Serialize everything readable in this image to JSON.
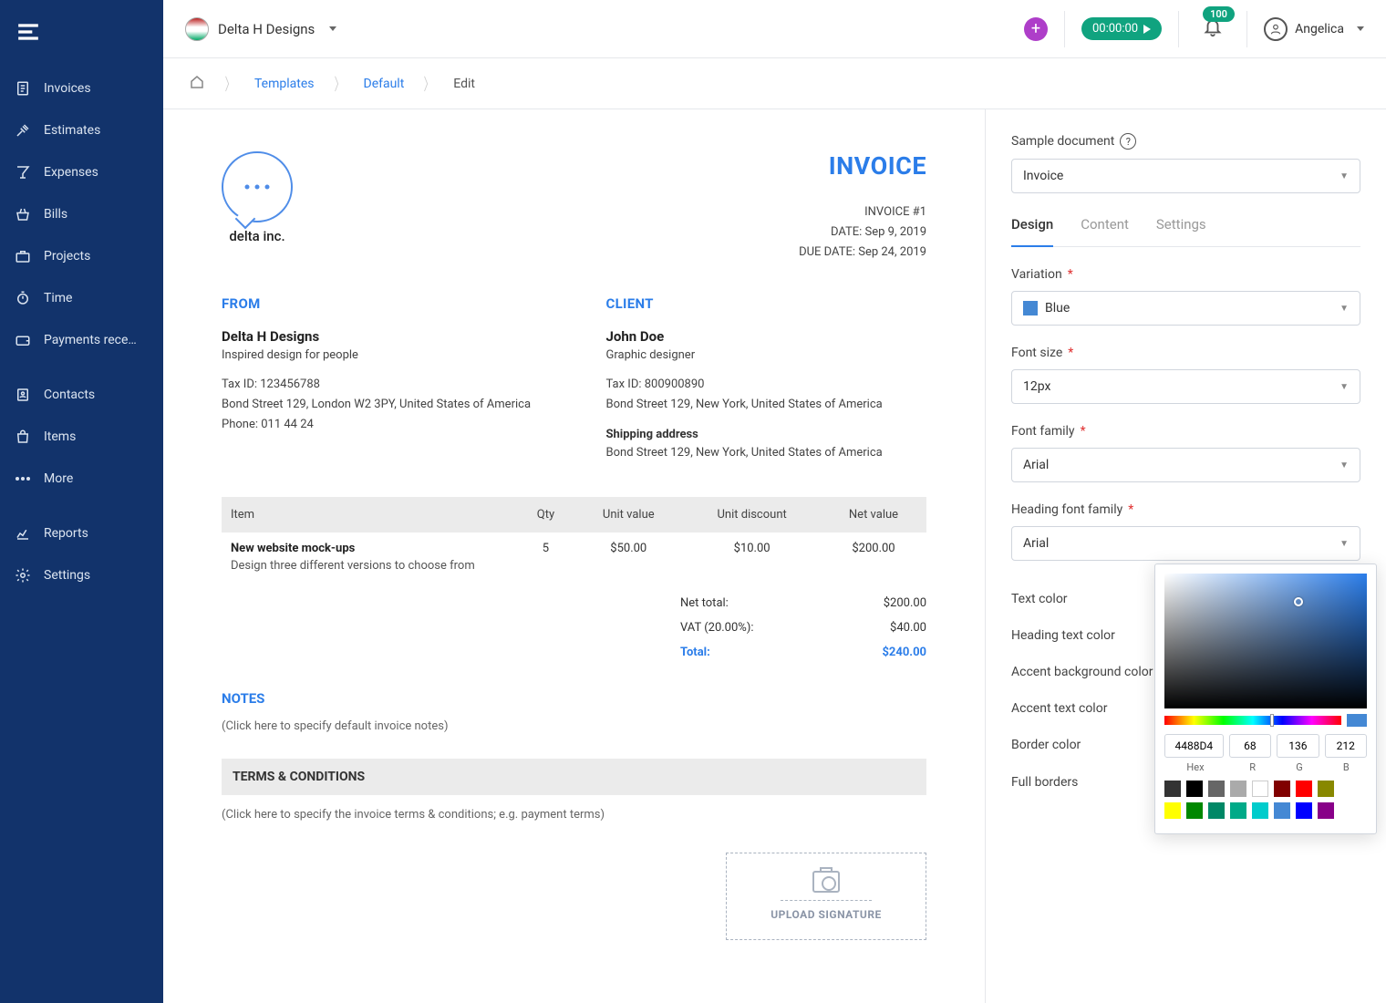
{
  "sidebar": {
    "items": [
      {
        "label": "Invoices"
      },
      {
        "label": "Estimates"
      },
      {
        "label": "Expenses"
      },
      {
        "label": "Bills"
      },
      {
        "label": "Projects"
      },
      {
        "label": "Time"
      },
      {
        "label": "Payments rece…"
      },
      {
        "label": "Contacts"
      },
      {
        "label": "Items"
      },
      {
        "label": "More"
      },
      {
        "label": "Reports"
      },
      {
        "label": "Settings"
      }
    ]
  },
  "topbar": {
    "company": "Delta H Designs",
    "timer": "00:00:00",
    "badge": "100",
    "user": "Angelica"
  },
  "crumb": {
    "c1": "Templates",
    "c2": "Default",
    "c3": "Edit"
  },
  "invoice": {
    "title": "INVOICE",
    "brand": "delta inc.",
    "num": "INVOICE #1",
    "date": "DATE: Sep 9, 2019",
    "due": "DUE DATE: Sep 24, 2019",
    "from": {
      "h": "FROM",
      "name": "Delta H Designs",
      "sub": "Inspired design for people",
      "tax": "Tax ID: 123456788",
      "addr": "Bond Street 129, London W2 3PY, United States of America",
      "phone": "Phone: 011 44 24"
    },
    "client": {
      "h": "CLIENT",
      "name": "John Doe",
      "sub": "Graphic designer",
      "tax": "Tax ID: 800900890",
      "addr": "Bond Street 129, New York, United States of America",
      "shipH": "Shipping address",
      "ship": "Bond Street 129, New York, United States of America"
    },
    "cols": {
      "item": "Item",
      "qty": "Qty",
      "unit": "Unit value",
      "disc": "Unit discount",
      "net": "Net value"
    },
    "row": {
      "name": "New website mock-ups",
      "desc": "Design three different versions to choose from",
      "qty": "5",
      "unit": "$50.00",
      "disc": "$10.00",
      "net": "$200.00"
    },
    "totals": {
      "netL": "Net total:",
      "netV": "$200.00",
      "vatL": "VAT (20.00%):",
      "vatV": "$40.00",
      "totL": "Total:",
      "totV": "$240.00"
    },
    "notesH": "NOTES",
    "notesHint": "(Click here to specify default invoice notes)",
    "termsH": "TERMS & CONDITIONS",
    "termsHint": "(Click here to specify the invoice terms & conditions; e.g. payment terms)",
    "upload": "UPLOAD SIGNATURE"
  },
  "inspector": {
    "sampleL": "Sample document",
    "sampleV": "Invoice",
    "tabs": {
      "design": "Design",
      "content": "Content",
      "settings": "Settings"
    },
    "variationL": "Variation",
    "variationV": "Blue",
    "fontsizeL": "Font size",
    "fontsizeV": "12px",
    "fontfamL": "Font family",
    "fontfamV": "Arial",
    "headfamL": "Heading font family",
    "headfamV": "Arial",
    "textcolorL": "Text color",
    "headcolorL": "Heading text color",
    "accentbgL": "Accent background color",
    "accenttxtL": "Accent text color",
    "bordercolorL": "Border color",
    "bordersL": "Full borders",
    "colors": {
      "text": "#3a3a3a",
      "heading": "#4488d4",
      "accentbg": "#eeeeee",
      "accenttxt": "#3a3a3a",
      "border": "#ffffff"
    }
  },
  "picker": {
    "hex": "4488D4",
    "r": "68",
    "g": "136",
    "b": "212",
    "lhex": "Hex",
    "lr": "R",
    "lg": "G",
    "lb": "B",
    "row1": [
      "#333333",
      "#000000",
      "#666666",
      "#aaaaaa",
      "#ffffff",
      "#800000",
      "#ff0000",
      "#888800"
    ],
    "row2": [
      "#ffff00",
      "#008800",
      "#008866",
      "#00aa88",
      "#00cccc",
      "#4488d4",
      "#0000ff",
      "#880088"
    ]
  }
}
